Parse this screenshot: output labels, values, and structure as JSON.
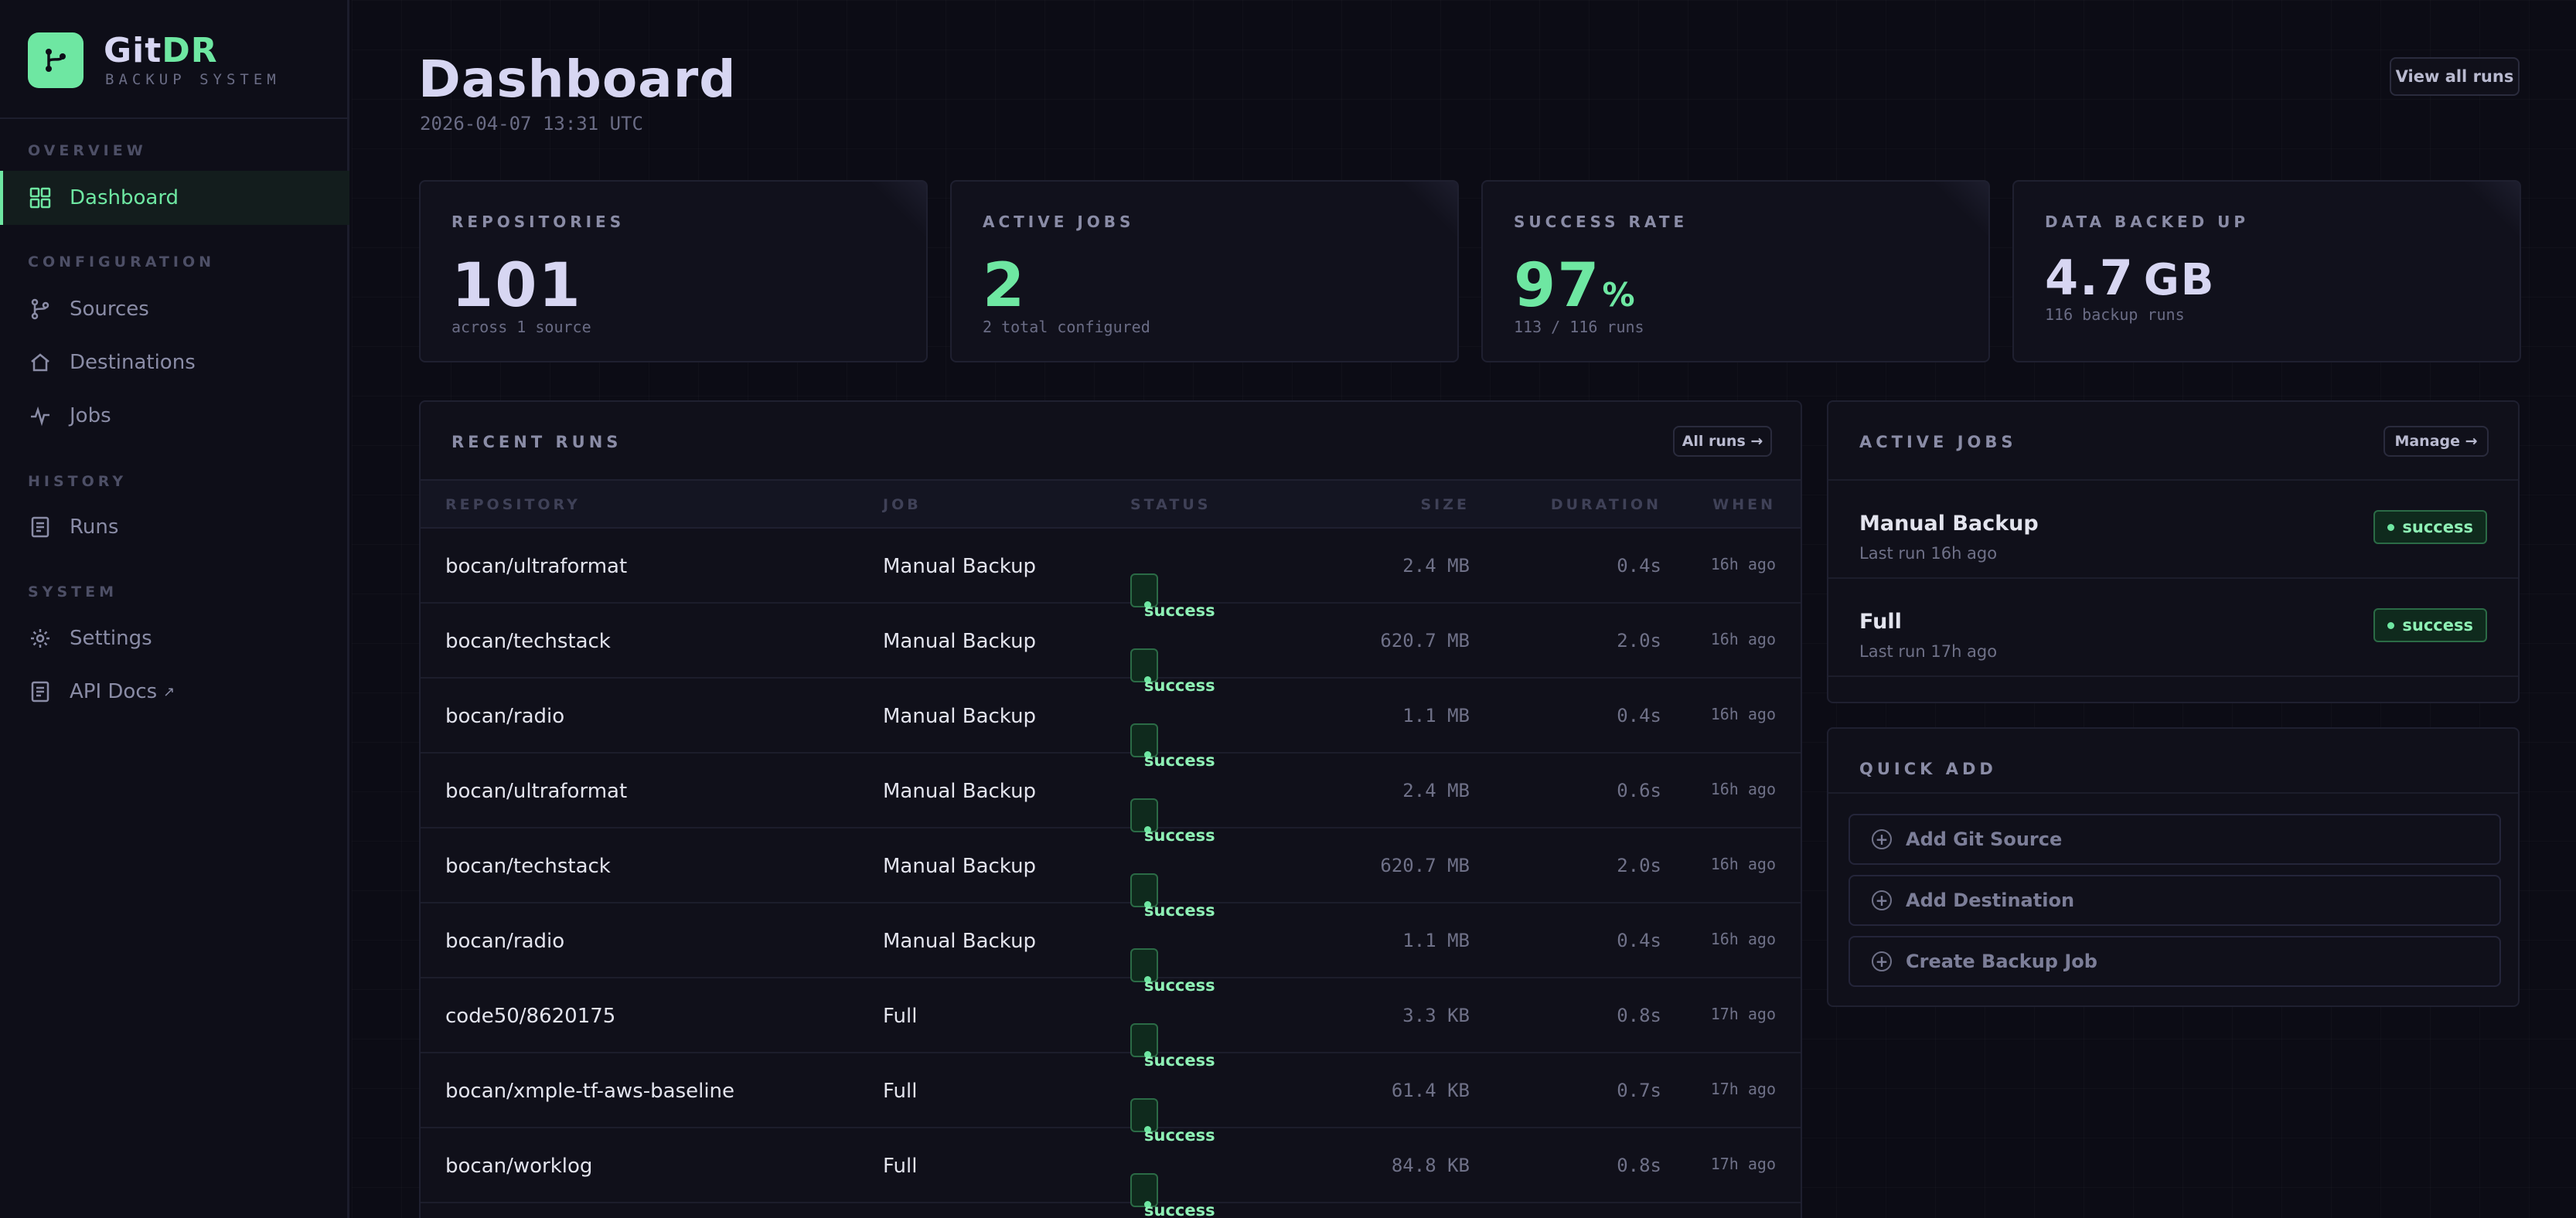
{
  "brand": {
    "name_part1": "Git",
    "name_part2": "DR",
    "subtitle": "BACKUP SYSTEM"
  },
  "sidebar": {
    "sections": [
      {
        "title": "OVERVIEW",
        "items": [
          {
            "label": "Dashboard",
            "icon": "grid-icon",
            "active": true
          }
        ]
      },
      {
        "title": "CONFIGURATION",
        "items": [
          {
            "label": "Sources",
            "icon": "git-branch-icon"
          },
          {
            "label": "Destinations",
            "icon": "home-icon"
          },
          {
            "label": "Jobs",
            "icon": "activity-icon"
          }
        ]
      },
      {
        "title": "HISTORY",
        "items": [
          {
            "label": "Runs",
            "icon": "document-icon"
          }
        ]
      },
      {
        "title": "SYSTEM",
        "items": [
          {
            "label": "Settings",
            "icon": "gear-icon"
          },
          {
            "label": "API Docs",
            "icon": "document-icon",
            "external": "↗"
          }
        ]
      }
    ]
  },
  "header": {
    "title": "Dashboard",
    "timestamp": "2026-04-07 13:31 UTC",
    "view_all_label": "View all runs"
  },
  "stats": [
    {
      "label": "REPOSITORIES",
      "value": "101",
      "sub": "across 1 source"
    },
    {
      "label": "ACTIVE JOBS",
      "value": "2",
      "sub": "2 total configured"
    },
    {
      "label": "SUCCESS RATE",
      "value": "97",
      "unit": "%",
      "sub": "113 / 116 runs"
    },
    {
      "label": "DATA BACKED UP",
      "value": "4.7",
      "unit": "GB",
      "sub": "116 backup runs"
    }
  ],
  "recent_runs": {
    "title": "RECENT RUNS",
    "all_runs_label": "All runs →",
    "columns": [
      "REPOSITORY",
      "JOB",
      "STATUS",
      "SIZE",
      "DURATION",
      "WHEN"
    ],
    "rows": [
      {
        "repo": "bocan/ultraformat",
        "job": "Manual Backup",
        "status": "success",
        "size": "2.4 MB",
        "duration": "0.4s",
        "when": "16h ago"
      },
      {
        "repo": "bocan/techstack",
        "job": "Manual Backup",
        "status": "success",
        "size": "620.7 MB",
        "duration": "2.0s",
        "when": "16h ago"
      },
      {
        "repo": "bocan/radio",
        "job": "Manual Backup",
        "status": "success",
        "size": "1.1 MB",
        "duration": "0.4s",
        "when": "16h ago"
      },
      {
        "repo": "bocan/ultraformat",
        "job": "Manual Backup",
        "status": "success",
        "size": "2.4 MB",
        "duration": "0.6s",
        "when": "16h ago"
      },
      {
        "repo": "bocan/techstack",
        "job": "Manual Backup",
        "status": "success",
        "size": "620.7 MB",
        "duration": "2.0s",
        "when": "16h ago"
      },
      {
        "repo": "bocan/radio",
        "job": "Manual Backup",
        "status": "success",
        "size": "1.1 MB",
        "duration": "0.4s",
        "when": "16h ago"
      },
      {
        "repo": "code50/8620175",
        "job": "Full",
        "status": "success",
        "size": "3.3 KB",
        "duration": "0.8s",
        "when": "17h ago"
      },
      {
        "repo": "bocan/xmple-tf-aws-baseline",
        "job": "Full",
        "status": "success",
        "size": "61.4 KB",
        "duration": "0.7s",
        "when": "17h ago"
      },
      {
        "repo": "bocan/worklog",
        "job": "Full",
        "status": "success",
        "size": "84.8 KB",
        "duration": "0.8s",
        "when": "17h ago"
      }
    ]
  },
  "active_jobs": {
    "title": "ACTIVE JOBS",
    "manage_label": "Manage →",
    "jobs": [
      {
        "name": "Manual Backup",
        "last_run": "Last run 16h ago",
        "status": "success"
      },
      {
        "name": "Full",
        "last_run": "Last run 17h ago",
        "status": "success"
      }
    ]
  },
  "quick_add": {
    "title": "QUICK ADD",
    "buttons": [
      {
        "label": "Add Git Source"
      },
      {
        "label": "Add Destination"
      },
      {
        "label": "Create Backup Job"
      }
    ]
  },
  "colors": {
    "accent": "#6ee7a2",
    "background": "#0c0c15",
    "panel": "#10101a"
  }
}
